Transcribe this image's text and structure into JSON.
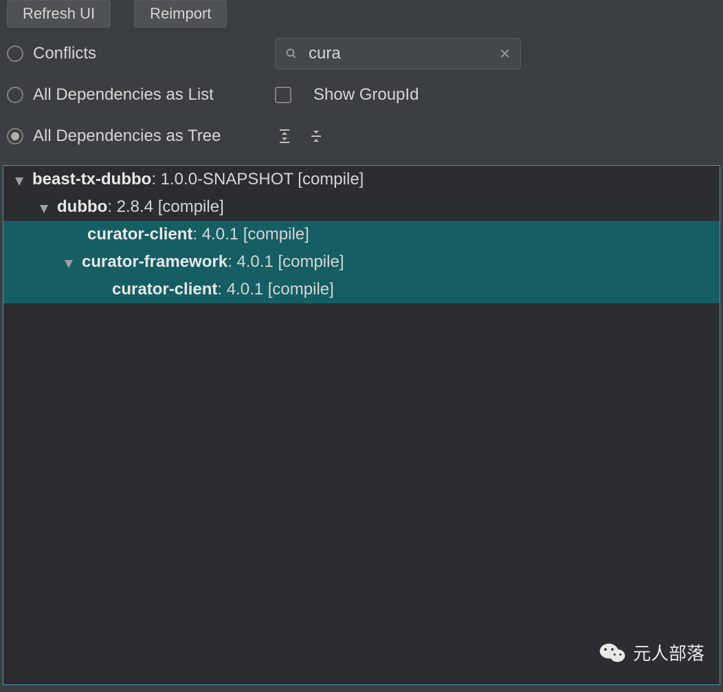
{
  "toolbar": {
    "refresh_label": "Refresh UI",
    "reimport_label": "Reimport"
  },
  "filters": {
    "conflicts_label": "Conflicts",
    "all_list_label": "All Dependencies as List",
    "all_tree_label": "All Dependencies as Tree",
    "show_groupid_label": "Show GroupId",
    "selected": "tree"
  },
  "search": {
    "value": "cura"
  },
  "tree": {
    "rows": [
      {
        "name": "beast-tx-dubbo",
        "suffix": " : 1.0.0-SNAPSHOT [compile]",
        "indent": 0,
        "expanded": true,
        "highlight": false,
        "hasDisclosure": true
      },
      {
        "name": "dubbo",
        "suffix": " : 2.8.4 [compile]",
        "indent": 1,
        "expanded": true,
        "highlight": false,
        "hasDisclosure": true
      },
      {
        "name": "curator-client",
        "suffix": " : 4.0.1 [compile]",
        "indent": 2,
        "expanded": false,
        "highlight": true,
        "hasDisclosure": false,
        "useIndent2b": true
      },
      {
        "name": "curator-framework",
        "suffix": " : 4.0.1 [compile]",
        "indent": 2,
        "expanded": true,
        "highlight": true,
        "hasDisclosure": true
      },
      {
        "name": "curator-client",
        "suffix": " : 4.0.1 [compile]",
        "indent": 3,
        "expanded": false,
        "highlight": true,
        "hasDisclosure": false
      }
    ]
  },
  "watermark": {
    "text": "元人部落"
  }
}
